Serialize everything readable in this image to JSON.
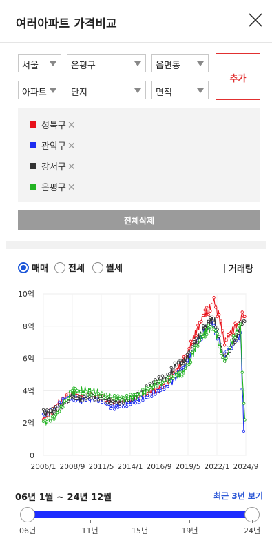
{
  "header": {
    "title": "여러아파트 가격비교"
  },
  "filters": {
    "region": "서울",
    "district": "은평구",
    "town": "읍면동",
    "property_type": "아파트",
    "complex": "단지",
    "area": "면적",
    "add_label": "추가"
  },
  "chips": [
    {
      "label": "성북구",
      "color": "#e8121b"
    },
    {
      "label": "관악구",
      "color": "#1c2cf0"
    },
    {
      "label": "강서구",
      "color": "#333333"
    },
    {
      "label": "은평구",
      "color": "#22b322"
    }
  ],
  "chip_remove": "✕",
  "delete_all": "전체삭제",
  "radios": {
    "sale": "매매",
    "jeonse": "전세",
    "monthly": "월세",
    "selected": "sale"
  },
  "volume_label": "거래량",
  "volume_checked": false,
  "chart_data": {
    "type": "line",
    "x_tick_labels": [
      "2006/1",
      "2008/9",
      "2011/5",
      "2014/1",
      "2016/9",
      "2019/5",
      "2022/1",
      "2024/9"
    ],
    "y_tick_labels": [
      "0",
      "2억",
      "4억",
      "6억",
      "8억",
      "10억"
    ],
    "ylim": [
      0,
      10
    ],
    "x_range": [
      2006.0,
      2025.0
    ],
    "unit": "억",
    "series": [
      {
        "name": "성북구",
        "color": "#e8121b",
        "points": [
          [
            2006.0,
            2.4
          ],
          [
            2007.0,
            2.9
          ],
          [
            2008.0,
            3.6
          ],
          [
            2008.7,
            3.9
          ],
          [
            2009.5,
            3.6
          ],
          [
            2010.5,
            3.6
          ],
          [
            2011.5,
            3.5
          ],
          [
            2012.5,
            3.3
          ],
          [
            2013.5,
            3.3
          ],
          [
            2014.5,
            3.5
          ],
          [
            2015.5,
            3.8
          ],
          [
            2016.5,
            4.1
          ],
          [
            2017.5,
            4.5
          ],
          [
            2018.5,
            5.3
          ],
          [
            2019.0,
            5.7
          ],
          [
            2019.5,
            6.2
          ],
          [
            2020.0,
            7.0
          ],
          [
            2020.5,
            7.6
          ],
          [
            2021.0,
            8.4
          ],
          [
            2021.5,
            8.7
          ],
          [
            2022.0,
            9.3
          ],
          [
            2022.5,
            8.3
          ],
          [
            2023.0,
            6.9
          ],
          [
            2023.5,
            7.5
          ],
          [
            2024.0,
            7.9
          ],
          [
            2024.5,
            8.4
          ],
          [
            2024.9,
            8.6
          ]
        ]
      },
      {
        "name": "관악구",
        "color": "#1c2cf0",
        "points": [
          [
            2006.0,
            2.5
          ],
          [
            2007.0,
            2.8
          ],
          [
            2008.0,
            3.4
          ],
          [
            2008.7,
            3.7
          ],
          [
            2009.5,
            3.4
          ],
          [
            2010.5,
            3.5
          ],
          [
            2011.5,
            3.4
          ],
          [
            2012.5,
            3.0
          ],
          [
            2013.5,
            3.2
          ],
          [
            2014.5,
            3.4
          ],
          [
            2015.5,
            3.6
          ],
          [
            2016.5,
            3.9
          ],
          [
            2017.5,
            4.2
          ],
          [
            2018.5,
            4.9
          ],
          [
            2019.0,
            5.1
          ],
          [
            2019.5,
            5.6
          ],
          [
            2020.0,
            6.3
          ],
          [
            2020.5,
            6.9
          ],
          [
            2021.0,
            7.5
          ],
          [
            2021.5,
            8.0
          ],
          [
            2022.0,
            8.2
          ],
          [
            2022.5,
            7.2
          ],
          [
            2023.0,
            6.2
          ],
          [
            2023.5,
            6.9
          ],
          [
            2024.0,
            7.3
          ],
          [
            2024.5,
            7.7
          ],
          [
            2024.8,
            1.5
          ]
        ]
      },
      {
        "name": "강서구",
        "color": "#333333",
        "points": [
          [
            2006.0,
            2.6
          ],
          [
            2007.0,
            2.7
          ],
          [
            2008.0,
            3.2
          ],
          [
            2008.7,
            3.6
          ],
          [
            2009.5,
            3.5
          ],
          [
            2010.5,
            3.7
          ],
          [
            2011.5,
            3.6
          ],
          [
            2012.5,
            3.4
          ],
          [
            2013.5,
            3.4
          ],
          [
            2014.5,
            3.6
          ],
          [
            2015.5,
            4.0
          ],
          [
            2016.5,
            4.5
          ],
          [
            2017.5,
            4.7
          ],
          [
            2018.5,
            5.6
          ],
          [
            2019.0,
            5.7
          ],
          [
            2019.5,
            6.0
          ],
          [
            2020.0,
            6.8
          ],
          [
            2020.5,
            7.3
          ],
          [
            2021.0,
            8.0
          ],
          [
            2021.5,
            8.4
          ],
          [
            2022.0,
            8.8
          ],
          [
            2022.5,
            7.6
          ],
          [
            2023.0,
            6.0
          ],
          [
            2023.5,
            6.8
          ],
          [
            2024.0,
            7.3
          ],
          [
            2024.5,
            8.1
          ],
          [
            2024.9,
            8.3
          ]
        ]
      },
      {
        "name": "은평구",
        "color": "#22b322",
        "points": [
          [
            2006.0,
            2.0
          ],
          [
            2007.0,
            2.3
          ],
          [
            2008.0,
            3.3
          ],
          [
            2008.7,
            3.9
          ],
          [
            2009.5,
            4.0
          ],
          [
            2010.5,
            4.0
          ],
          [
            2011.5,
            3.8
          ],
          [
            2012.5,
            3.6
          ],
          [
            2013.5,
            3.5
          ],
          [
            2014.5,
            3.6
          ],
          [
            2015.5,
            3.9
          ],
          [
            2016.5,
            4.3
          ],
          [
            2017.5,
            4.6
          ],
          [
            2018.5,
            5.0
          ],
          [
            2019.0,
            5.2
          ],
          [
            2019.5,
            5.7
          ],
          [
            2020.0,
            6.4
          ],
          [
            2020.5,
            7.2
          ],
          [
            2021.0,
            7.7
          ],
          [
            2021.5,
            8.0
          ],
          [
            2022.0,
            8.0
          ],
          [
            2022.5,
            7.0
          ],
          [
            2023.0,
            5.7
          ],
          [
            2023.5,
            6.5
          ],
          [
            2024.0,
            7.4
          ],
          [
            2024.5,
            7.9
          ],
          [
            2024.9,
            2.2
          ]
        ]
      }
    ]
  },
  "range": {
    "label": "06년 1월 ~ 24년 12월",
    "recent": "최근 3년 보기",
    "start": "06년",
    "end": "24년",
    "selected_start": 2006,
    "selected_end": 2024
  },
  "slider_ticks": [
    {
      "label": "06년",
      "value": 2006
    },
    {
      "label": "11년",
      "value": 2011
    },
    {
      "label": "15년",
      "value": 2015
    },
    {
      "label": "19년",
      "value": 2019
    },
    {
      "label": "24년",
      "value": 2024
    }
  ]
}
